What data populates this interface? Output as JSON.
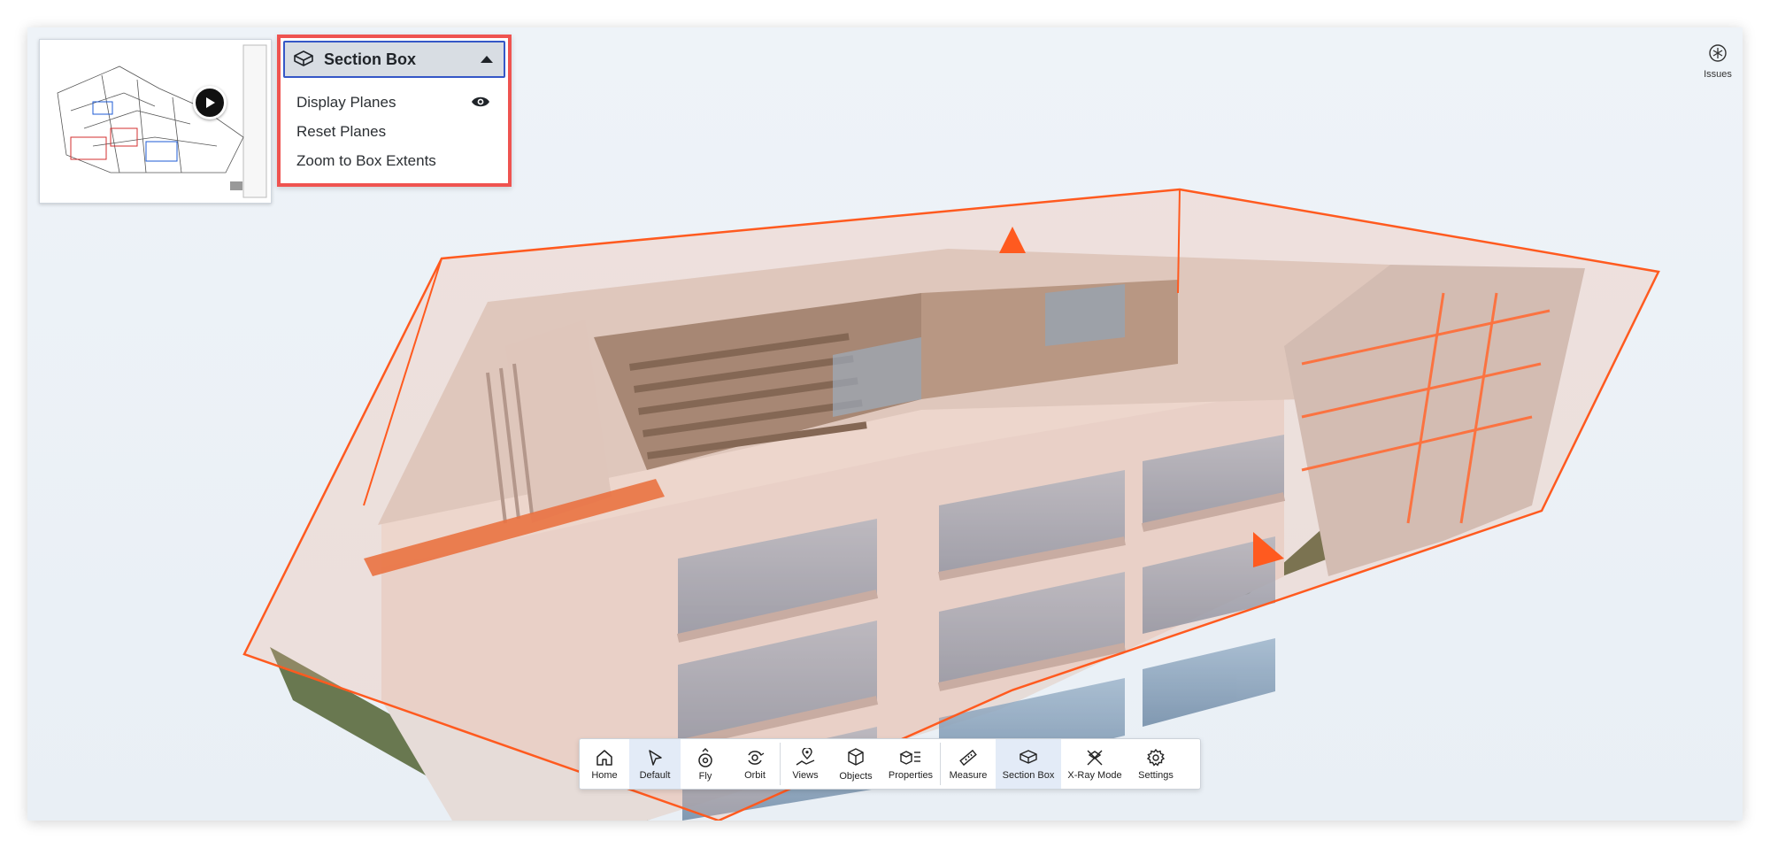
{
  "section_box": {
    "title": "Section Box",
    "items": [
      {
        "label": "Display Planes",
        "icon": "eye-icon"
      },
      {
        "label": "Reset Planes"
      },
      {
        "label": "Zoom to Box Extents"
      }
    ]
  },
  "issues": {
    "label": "Issues",
    "icon": "issues-icon"
  },
  "toolbar": {
    "active": "Section Box",
    "buttons": [
      {
        "label": "Home",
        "icon": "home-icon"
      },
      {
        "label": "Default",
        "icon": "cursor-icon"
      },
      {
        "label": "Fly",
        "icon": "fly-icon"
      },
      {
        "label": "Orbit",
        "icon": "orbit-icon"
      },
      {
        "label": "Views",
        "icon": "views-icon"
      },
      {
        "label": "Objects",
        "icon": "objects-icon"
      },
      {
        "label": "Properties",
        "icon": "properties-icon"
      },
      {
        "label": "Measure",
        "icon": "ruler-icon"
      },
      {
        "label": "Section Box",
        "icon": "section-box-icon"
      },
      {
        "label": "X-Ray Mode",
        "icon": "xray-icon"
      },
      {
        "label": "Settings",
        "icon": "gear-icon"
      }
    ]
  },
  "colors": {
    "section_box_outline": "#ff5a1f",
    "highlight_border": "#ef5350",
    "active_button": "#e3ebf7"
  }
}
